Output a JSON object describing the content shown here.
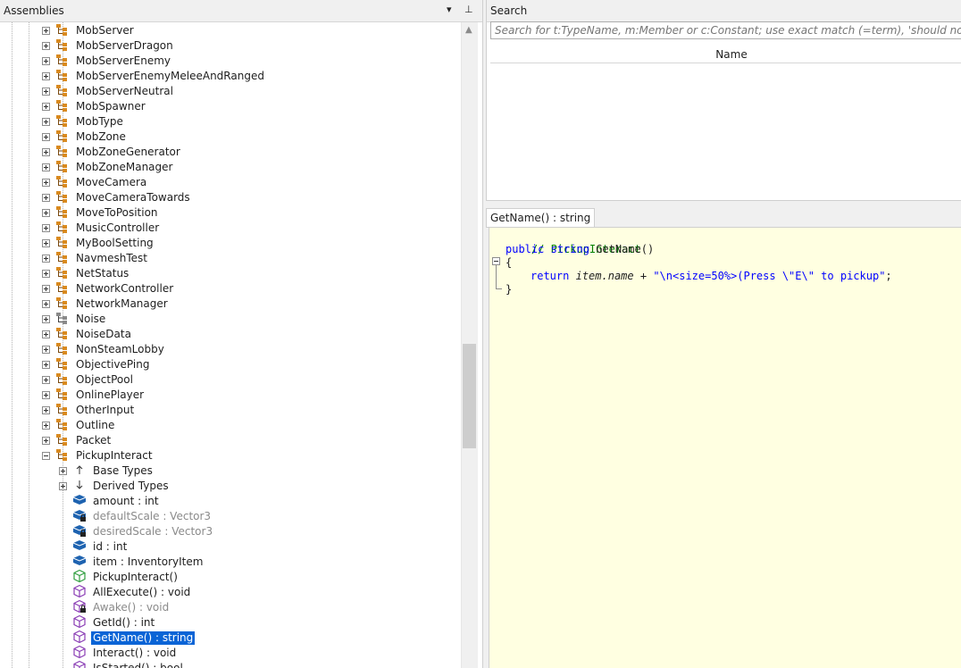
{
  "assemblies_panel": {
    "title": "Assemblies",
    "dropdown_glyph": "▾",
    "pin_glyph": "⊥"
  },
  "tree": {
    "classes": [
      "MobServer",
      "MobServerDragon",
      "MobServerEnemy",
      "MobServerEnemyMeleeAndRanged",
      "MobServerNeutral",
      "MobSpawner",
      "MobType",
      "MobZone",
      "MobZoneGenerator",
      "MobZoneManager",
      "MoveCamera",
      "MoveCameraTowards",
      "MoveToPosition",
      "MusicController",
      "MyBoolSetting",
      "NavmeshTest",
      "NetStatus",
      "NetworkController",
      "NetworkManager",
      "Noise",
      "NoiseData",
      "NonSteamLobby",
      "ObjectivePing",
      "ObjectPool",
      "OnlinePlayer",
      "OtherInput",
      "Outline",
      "Packet"
    ],
    "expanded_class": "PickupInteract",
    "children": [
      {
        "label": "Base Types",
        "icon": "base-types-icon"
      },
      {
        "label": "Derived Types",
        "icon": "derived-types-icon"
      },
      {
        "label": "amount : int",
        "icon": "field-icon"
      },
      {
        "label": "defaultScale : Vector3",
        "icon": "private-field-icon"
      },
      {
        "label": "desiredScale : Vector3",
        "icon": "private-field-icon"
      },
      {
        "label": "id : int",
        "icon": "field-icon"
      },
      {
        "label": "item : InventoryItem",
        "icon": "field-icon"
      },
      {
        "label": "PickupInteract()",
        "icon": "constructor-icon"
      },
      {
        "label": "AllExecute() : void",
        "icon": "method-icon"
      },
      {
        "label": "Awake() : void",
        "icon": "private-method-icon"
      },
      {
        "label": "GetId() : int",
        "icon": "method-icon"
      },
      {
        "label": "GetName() : string",
        "icon": "method-icon"
      },
      {
        "label": "Interact() : void",
        "icon": "method-icon"
      },
      {
        "label": "IsStarted() : bool",
        "icon": "method-icon"
      }
    ],
    "selected": "GetName() : string"
  },
  "scrollbar": {
    "position_fraction": 0.6,
    "thumb_fraction": 0.17
  },
  "search": {
    "title": "Search",
    "placeholder": "Search for t:TypeName, m:Member or c:Constant; use exact match (=term), 'should not contain' (-term) or 'must contain' (+term)",
    "column_name": "Name"
  },
  "code": {
    "tab_label": "GetName() : string",
    "comment": "// PickupInteract",
    "kw_public": "public",
    "kw_string": "string",
    "method_name": "GetName",
    "parens": "()",
    "open_brace": "{",
    "kw_return": "return",
    "item_name": "item.name",
    "plus": "+",
    "string_literal": "\"\\n<size=50%>(Press \\\"E\\\" to pickup\"",
    "semicolon": ";",
    "close_brace": "}"
  },
  "colors": {
    "selection": "#0a64d6",
    "class_icon": "#d98a1f",
    "field_icon": "#1e63b0",
    "method_icon": "#8a3db5",
    "code_bg": "#ffffe1"
  }
}
